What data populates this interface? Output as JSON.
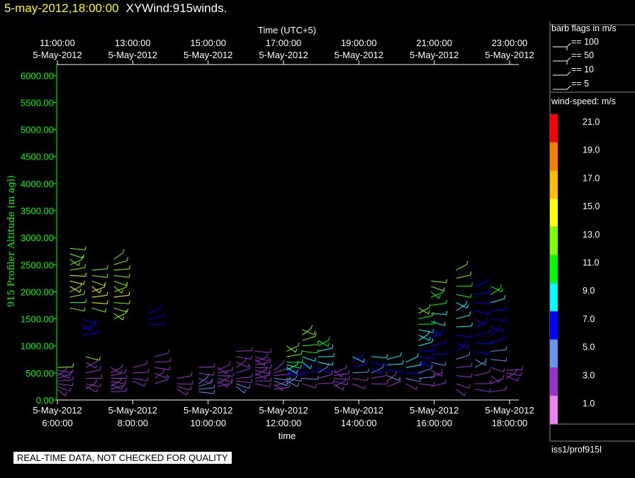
{
  "header": {
    "datetime": "5-may-2012,18:00:00",
    "product": "XYWind:915winds."
  },
  "legend": {
    "flags_title": "barb flags in m/s",
    "flags": [
      "== 100",
      "== 50",
      "== 10",
      "== 5"
    ],
    "speed_title": "wind-speed: m/s",
    "speed_scale": [
      {
        "label": "21.0",
        "color": "#ff0000"
      },
      {
        "label": "19.0",
        "color": "#ff7f00"
      },
      {
        "label": "17.0",
        "color": "#ffbf00"
      },
      {
        "label": "15.0",
        "color": "#ffff00"
      },
      {
        "label": "13.0",
        "color": "#7fff00"
      },
      {
        "label": "11.0",
        "color": "#00ff00"
      },
      {
        "label": "9.0",
        "color": "#00ffff"
      },
      {
        "label": "7.0",
        "color": "#0000ff"
      },
      {
        "label": "5.0",
        "color": "#6495ed"
      },
      {
        "label": "3.0",
        "color": "#9932cc"
      },
      {
        "label": "1.0",
        "color": "#ee82ee"
      }
    ],
    "source": "iss1/prof915l"
  },
  "footer": {
    "qc_note": "REAL-TIME DATA, NOT CHECKED FOR QUALITY"
  },
  "chart_data": {
    "type": "scatter",
    "title": "",
    "xlabel": "time",
    "x2label": "Time (UTC+5)",
    "ylabel": "915 Profiler Altitude (m agl)",
    "xlim": [
      "5-May-2012 5:55:00",
      "5-May-2012 18:30:00"
    ],
    "ylim": [
      0,
      6200
    ],
    "x_ticks": [
      {
        "date": "5-May-2012",
        "time": "6:00:00",
        "hours": 6
      },
      {
        "date": "5-May-2012",
        "time": "8:00:00",
        "hours": 8
      },
      {
        "date": "5-May-2012",
        "time": "10:00:00",
        "hours": 10
      },
      {
        "date": "5-May-2012",
        "time": "12:00:00",
        "hours": 12
      },
      {
        "date": "5-May-2012",
        "time": "14:00:00",
        "hours": 14
      },
      {
        "date": "5-May-2012",
        "time": "16:00:00",
        "hours": 16
      },
      {
        "date": "5-May-2012",
        "time": "18:00:00",
        "hours": 18
      }
    ],
    "x2_ticks": [
      {
        "time": "11:00:00",
        "date": "5-May-2012",
        "hours": 6
      },
      {
        "time": "13:00:00",
        "date": "5-May-2012",
        "hours": 8
      },
      {
        "time": "15:00:00",
        "date": "5-May-2012",
        "hours": 10
      },
      {
        "time": "17:00:00",
        "date": "5-May-2012",
        "hours": 12
      },
      {
        "time": "19:00:00",
        "date": "5-May-2012",
        "hours": 14
      },
      {
        "time": "21:00:00",
        "date": "5-May-2012",
        "hours": 16
      },
      {
        "time": "23:00:00",
        "date": "5-May-2012",
        "hours": 18
      }
    ],
    "y_ticks": [
      "0.00",
      "500.00",
      "1000.00",
      "1500.00",
      "2000.00",
      "2500.00",
      "3000.00",
      "3500.00",
      "4000.00",
      "4500.00",
      "5000.00",
      "5500.00",
      "6000.00"
    ],
    "series": [
      {
        "x": "6:00",
        "heights": [
          200,
          250,
          300,
          350,
          400,
          450,
          500,
          550,
          600
        ],
        "speeds": [
          2,
          2,
          2,
          3,
          3,
          2,
          2,
          3,
          12
        ]
      },
      {
        "x": "6:20",
        "heights": [
          1700,
          1800,
          1900,
          2000,
          2100,
          2200,
          2300,
          2400,
          2500,
          2600,
          2700,
          2800
        ],
        "speeds": [
          12,
          12,
          13,
          13,
          14,
          14,
          14,
          13,
          13,
          13,
          13,
          13
        ]
      },
      {
        "x": "6:40",
        "heights": [
          1200,
          1300,
          1400,
          1500
        ],
        "speeds": [
          7,
          7,
          7,
          7
        ]
      },
      {
        "x": "6:45",
        "heights": [
          200,
          250,
          300,
          400,
          500,
          600,
          700,
          800
        ],
        "speeds": [
          2,
          2,
          3,
          3,
          2,
          2,
          3,
          12
        ]
      },
      {
        "x": "6:55",
        "heights": [
          1700,
          1800,
          1900,
          2000,
          2100,
          2200,
          2300,
          2400
        ],
        "speeds": [
          13,
          14,
          14,
          15,
          14,
          13,
          12,
          12
        ]
      },
      {
        "x": "7:25",
        "heights": [
          150,
          200,
          250,
          300,
          350,
          400,
          450,
          500,
          600
        ],
        "speeds": [
          2,
          2,
          2,
          3,
          3,
          2,
          2,
          3,
          3
        ]
      },
      {
        "x": "7:30",
        "heights": [
          1500,
          1600,
          1700,
          1800,
          1900,
          2000,
          2100,
          2200,
          2300,
          2400,
          2500,
          2600
        ],
        "speeds": [
          12,
          12,
          13,
          13,
          14,
          13,
          13,
          13,
          12,
          12,
          12,
          12
        ]
      },
      {
        "x": "8:00",
        "heights": [
          350,
          400,
          500,
          600
        ],
        "speeds": [
          3,
          3,
          3,
          3
        ]
      },
      {
        "x": "8:25",
        "heights": [
          1400,
          1500,
          1600
        ],
        "speeds": [
          7,
          7,
          7
        ]
      },
      {
        "x": "8:35",
        "heights": [
          300,
          400,
          500,
          600,
          700,
          800
        ],
        "speeds": [
          2,
          2,
          3,
          3,
          3,
          3
        ]
      },
      {
        "x": "9:10",
        "heights": [
          200,
          250,
          300,
          400
        ],
        "speeds": [
          2,
          2,
          3,
          3
        ]
      },
      {
        "x": "9:45",
        "heights": [
          150,
          200,
          250,
          300,
          400,
          500,
          600
        ],
        "speeds": [
          5,
          5,
          5,
          5,
          3,
          3,
          3
        ]
      },
      {
        "x": "10:15",
        "heights": [
          250,
          300,
          350,
          400,
          450,
          500,
          550,
          600
        ],
        "speeds": [
          2,
          2,
          3,
          3,
          3,
          2,
          2,
          3
        ]
      },
      {
        "x": "10:45",
        "heights": [
          250,
          300,
          350,
          400,
          500,
          600,
          700,
          800,
          900
        ],
        "speeds": [
          5,
          5,
          3,
          3,
          3,
          3,
          3,
          3,
          3
        ]
      },
      {
        "x": "11:15",
        "heights": [
          300,
          350,
          400,
          450,
          500,
          550,
          600,
          650,
          700,
          750,
          800,
          900
        ],
        "speeds": [
          3,
          3,
          3,
          2,
          2,
          3,
          3,
          2,
          2,
          3,
          3,
          3
        ]
      },
      {
        "x": "11:45",
        "heights": [
          200,
          250,
          300,
          350,
          400,
          450,
          500,
          550
        ],
        "speeds": [
          3,
          3,
          3,
          5,
          5,
          3,
          3,
          3
        ]
      },
      {
        "x": "12:05",
        "heights": [
          300,
          350,
          400,
          450,
          500,
          550,
          600,
          650,
          700,
          800,
          900,
          1000
        ],
        "speeds": [
          5,
          5,
          5,
          7,
          7,
          9,
          9,
          11,
          11,
          12,
          12,
          12
        ]
      },
      {
        "x": "12:30",
        "heights": [
          300,
          400,
          500,
          600,
          700,
          800,
          900,
          1000,
          1100,
          1200,
          1300
        ],
        "speeds": [
          3,
          5,
          7,
          7,
          9,
          9,
          11,
          11,
          12,
          12,
          12
        ]
      },
      {
        "x": "12:55",
        "heights": [
          300,
          400,
          500,
          600,
          700,
          800,
          900,
          1000,
          1100
        ],
        "speeds": [
          3,
          3,
          5,
          7,
          9,
          9,
          9,
          11,
          11
        ]
      },
      {
        "x": "13:20",
        "heights": [
          250,
          300,
          350,
          400,
          450,
          500,
          550
        ],
        "speeds": [
          2,
          2,
          3,
          3,
          3,
          3,
          3
        ]
      },
      {
        "x": "13:50",
        "heights": [
          300,
          400,
          500,
          600,
          700,
          800
        ],
        "speeds": [
          3,
          3,
          5,
          7,
          7,
          9
        ]
      },
      {
        "x": "14:20",
        "heights": [
          300,
          400,
          500,
          600,
          700,
          800
        ],
        "speeds": [
          3,
          3,
          5,
          7,
          7,
          9
        ]
      },
      {
        "x": "14:45",
        "heights": [
          250,
          350,
          450,
          550,
          650,
          750
        ],
        "speeds": [
          3,
          3,
          5,
          7,
          9,
          9
        ]
      },
      {
        "x": "15:15",
        "heights": [
          300,
          400,
          500,
          600,
          700
        ],
        "speeds": [
          3,
          5,
          7,
          9,
          9
        ]
      },
      {
        "x": "15:35",
        "heights": [
          300,
          400,
          500,
          600,
          700,
          800,
          900,
          1000,
          1100,
          1200,
          1300,
          1400,
          1500,
          1600,
          1700
        ],
        "speeds": [
          3,
          5,
          5,
          7,
          7,
          7,
          7,
          9,
          9,
          9,
          9,
          11,
          11,
          12,
          12
        ]
      },
      {
        "x": "15:55",
        "heights": [
          250,
          400,
          550,
          700,
          850,
          1000,
          1150,
          1300,
          1450,
          1600,
          1750,
          1900,
          2000,
          2100,
          2200
        ],
        "speeds": [
          2,
          3,
          3,
          5,
          7,
          7,
          7,
          7,
          9,
          9,
          11,
          11,
          11,
          12,
          12
        ]
      },
      {
        "x": "16:35",
        "heights": [
          200,
          300,
          450,
          600,
          750,
          900,
          1050,
          1200,
          1350,
          1500,
          1650,
          1800,
          1950,
          2100,
          2250,
          2400
        ],
        "speeds": [
          2,
          3,
          3,
          3,
          5,
          7,
          7,
          7,
          9,
          9,
          9,
          9,
          11,
          11,
          12,
          12
        ]
      },
      {
        "x": "17:05",
        "heights": [
          200,
          300,
          450,
          600,
          750,
          900,
          1050,
          1200,
          1350,
          1500,
          1650,
          1800,
          1950,
          2100
        ],
        "speeds": [
          2,
          3,
          3,
          5,
          5,
          7,
          7,
          7,
          7,
          7,
          7,
          7,
          7,
          7
        ]
      },
      {
        "x": "17:30",
        "heights": [
          150,
          300,
          450,
          600,
          750,
          900,
          1050,
          1200,
          1350,
          1500,
          1650,
          1800,
          1950,
          2100
        ],
        "speeds": [
          2,
          3,
          3,
          3,
          5,
          5,
          7,
          7,
          7,
          7,
          7,
          9,
          11,
          11
        ]
      },
      {
        "x": "17:55",
        "heights": [
          400,
          450,
          500,
          550
        ],
        "speeds": [
          3,
          3,
          3,
          3
        ]
      }
    ]
  }
}
